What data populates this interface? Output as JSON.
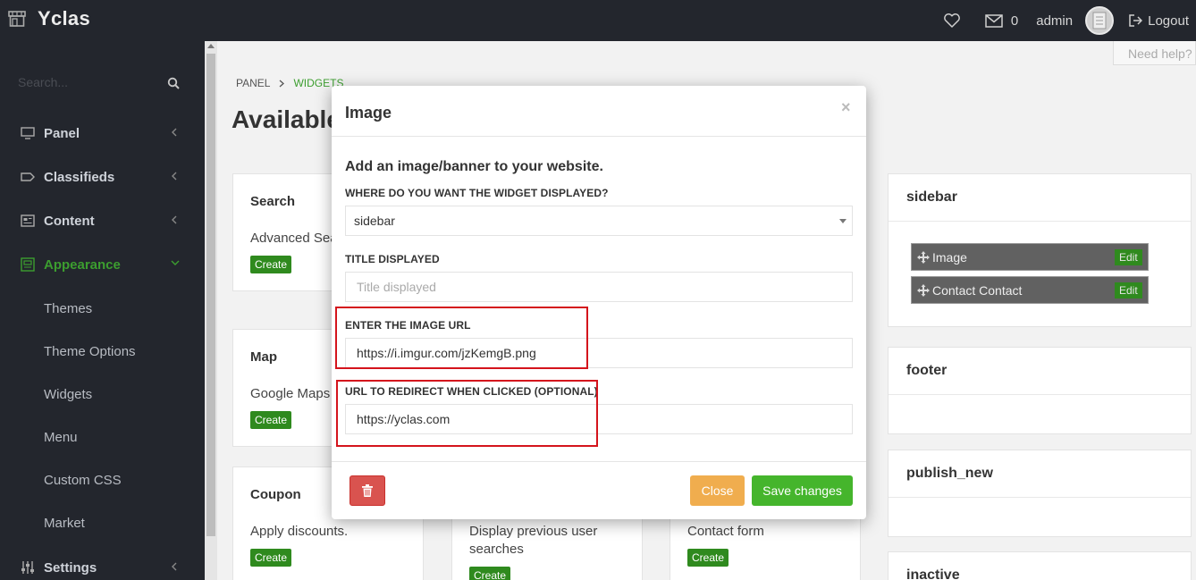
{
  "topbar": {
    "brand": "Yclas",
    "message_count": "0",
    "username": "admin",
    "logout_label": "Logout"
  },
  "sidebar": {
    "search_placeholder": "Search...",
    "items": [
      {
        "label": "Panel",
        "icon": "monitor-icon",
        "expanded": false
      },
      {
        "label": "Classifieds",
        "icon": "tag-icon",
        "expanded": false
      },
      {
        "label": "Content",
        "icon": "newspaper-icon",
        "expanded": false
      },
      {
        "label": "Appearance",
        "icon": "palette-icon",
        "expanded": true
      },
      {
        "label": "Settings",
        "icon": "sliders-icon",
        "expanded": false
      }
    ],
    "sub_items": [
      "Themes",
      "Theme Options",
      "Widgets",
      "Menu",
      "Custom CSS",
      "Market"
    ],
    "active_color": "#3c9e2f"
  },
  "main": {
    "breadcrumb": [
      "PANEL",
      "WIDGETS"
    ],
    "page_title": "Available",
    "need_help": "Need help?",
    "create_label": "Create",
    "widgets": [
      {
        "title": "Search",
        "desc": "Advanced Sear"
      },
      {
        "title": "Map",
        "desc": "Google Maps v"
      },
      {
        "title": "Coupon",
        "desc": "Apply discounts."
      },
      {
        "title": "",
        "desc": "Display previous user searches"
      },
      {
        "title": "",
        "desc": "Contact form"
      }
    ],
    "placeholders": [
      {
        "title": "sidebar",
        "widgets": [
          "Image",
          "Contact Contact"
        ]
      },
      {
        "title": "footer"
      },
      {
        "title": "publish_new"
      },
      {
        "title": "inactive"
      }
    ],
    "edit_label": "Edit"
  },
  "modal": {
    "title": "Image",
    "close_symbol": "×",
    "subheading": "Add an image/banner to your website.",
    "where_label": "WHERE DO YOU WANT THE WIDGET DISPLAYED?",
    "where_value": "sidebar",
    "title_label": "TITLE DISPLAYED",
    "title_placeholder": "Title displayed",
    "image_url_label": "ENTER THE IMAGE URL",
    "image_url_value": "https://i.imgur.com/jzKemgB.png",
    "redirect_label": "URL TO REDIRECT WHEN CLICKED (OPTIONAL)",
    "redirect_value": "https://yclas.com",
    "close_button": "Close",
    "save_button": "Save changes",
    "highlight_color": "#d4141c"
  }
}
